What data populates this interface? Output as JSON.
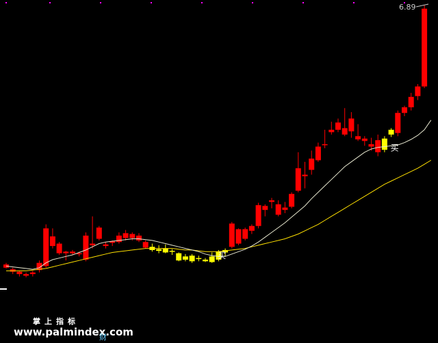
{
  "chart_data": {
    "type": "candlestick",
    "ylim": [
      3.3,
      6.93
    ],
    "price_label": "6.89",
    "signal_label": "买",
    "signals": [
      {
        "index": 32,
        "price": 3.82
      },
      {
        "index": 58,
        "price": 5.16
      }
    ],
    "candles": [
      {
        "o": 3.7,
        "h": 3.72,
        "l": 3.65,
        "c": 3.66,
        "color": "red"
      },
      {
        "o": 3.64,
        "h": 3.66,
        "l": 3.58,
        "c": 3.61,
        "color": "red"
      },
      {
        "o": 3.61,
        "h": 3.62,
        "l": 3.55,
        "c": 3.58,
        "color": "red"
      },
      {
        "o": 3.58,
        "h": 3.6,
        "l": 3.54,
        "c": 3.56,
        "color": "red"
      },
      {
        "o": 3.58,
        "h": 3.62,
        "l": 3.55,
        "c": 3.6,
        "color": "red"
      },
      {
        "o": 3.63,
        "h": 3.75,
        "l": 3.6,
        "c": 3.72,
        "color": "red"
      },
      {
        "o": 3.68,
        "h": 4.2,
        "l": 3.66,
        "c": 4.15,
        "color": "red"
      },
      {
        "o": 4.05,
        "h": 4.15,
        "l": 3.9,
        "c": 3.93,
        "color": "red"
      },
      {
        "o": 3.96,
        "h": 3.98,
        "l": 3.82,
        "c": 3.84,
        "color": "red"
      },
      {
        "o": 3.84,
        "h": 3.87,
        "l": 3.75,
        "c": 3.86,
        "color": "red"
      },
      {
        "o": 3.86,
        "h": 3.88,
        "l": 3.82,
        "c": 3.84,
        "color": "red"
      },
      {
        "o": 3.83,
        "h": 3.86,
        "l": 3.8,
        "c": 3.84,
        "color": "red"
      },
      {
        "o": 3.76,
        "h": 4.1,
        "l": 3.74,
        "c": 4.06,
        "color": "red"
      },
      {
        "o": 3.94,
        "h": 4.3,
        "l": 3.9,
        "c": 3.96,
        "color": "red"
      },
      {
        "o": 4.02,
        "h": 4.18,
        "l": 4.0,
        "c": 4.16,
        "color": "red"
      },
      {
        "o": 3.95,
        "h": 3.98,
        "l": 3.9,
        "c": 3.93,
        "color": "red"
      },
      {
        "o": 3.97,
        "h": 4.0,
        "l": 3.93,
        "c": 3.99,
        "color": "red"
      },
      {
        "o": 3.98,
        "h": 4.1,
        "l": 3.96,
        "c": 4.06,
        "color": "red"
      },
      {
        "o": 4.03,
        "h": 4.13,
        "l": 4.0,
        "c": 4.09,
        "color": "red"
      },
      {
        "o": 4.03,
        "h": 4.1,
        "l": 4.0,
        "c": 4.08,
        "color": "red"
      },
      {
        "o": 4.06,
        "h": 4.09,
        "l": 3.98,
        "c": 4.0,
        "color": "red"
      },
      {
        "o": 3.98,
        "h": 4.0,
        "l": 3.9,
        "c": 3.91,
        "color": "red"
      },
      {
        "o": 3.92,
        "h": 3.96,
        "l": 3.86,
        "c": 3.88,
        "color": "yellow"
      },
      {
        "o": 3.89,
        "h": 3.94,
        "l": 3.84,
        "c": 3.87,
        "color": "yellow"
      },
      {
        "o": 3.9,
        "h": 3.95,
        "l": 3.84,
        "c": 3.85,
        "color": "yellow"
      },
      {
        "o": 3.87,
        "h": 3.89,
        "l": 3.82,
        "c": 3.86,
        "color": "yellow"
      },
      {
        "o": 3.84,
        "h": 3.85,
        "l": 3.74,
        "c": 3.75,
        "color": "yellow"
      },
      {
        "o": 3.8,
        "h": 3.83,
        "l": 3.74,
        "c": 3.76,
        "color": "yellow"
      },
      {
        "o": 3.81,
        "h": 3.83,
        "l": 3.72,
        "c": 3.74,
        "color": "yellow"
      },
      {
        "o": 3.78,
        "h": 3.81,
        "l": 3.74,
        "c": 3.77,
        "color": "yellow"
      },
      {
        "o": 3.76,
        "h": 3.78,
        "l": 3.73,
        "c": 3.74,
        "color": "yellow"
      },
      {
        "o": 3.8,
        "h": 3.85,
        "l": 3.72,
        "c": 3.73,
        "color": "yellow"
      },
      {
        "o": 3.76,
        "h": 3.88,
        "l": 3.74,
        "c": 3.86,
        "color": "yellow"
      },
      {
        "o": 3.85,
        "h": 3.9,
        "l": 3.8,
        "c": 3.88,
        "color": "yellow"
      },
      {
        "o": 3.92,
        "h": 4.23,
        "l": 3.9,
        "c": 4.21,
        "color": "red"
      },
      {
        "o": 3.96,
        "h": 4.15,
        "l": 3.94,
        "c": 4.14,
        "color": "red"
      },
      {
        "o": 4.02,
        "h": 4.16,
        "l": 4.0,
        "c": 4.14,
        "color": "red"
      },
      {
        "o": 4.12,
        "h": 4.2,
        "l": 4.08,
        "c": 4.18,
        "color": "red"
      },
      {
        "o": 4.18,
        "h": 4.47,
        "l": 4.15,
        "c": 4.44,
        "color": "red"
      },
      {
        "o": 4.38,
        "h": 4.45,
        "l": 4.3,
        "c": 4.43,
        "color": "red"
      },
      {
        "o": 4.48,
        "h": 4.53,
        "l": 4.4,
        "c": 4.5,
        "color": "red"
      },
      {
        "o": 4.32,
        "h": 4.5,
        "l": 4.3,
        "c": 4.45,
        "color": "red"
      },
      {
        "o": 4.38,
        "h": 4.48,
        "l": 4.34,
        "c": 4.41,
        "color": "red"
      },
      {
        "o": 4.42,
        "h": 4.6,
        "l": 4.4,
        "c": 4.58,
        "color": "red"
      },
      {
        "o": 4.62,
        "h": 5.1,
        "l": 4.6,
        "c": 4.9,
        "color": "red"
      },
      {
        "o": 4.82,
        "h": 4.98,
        "l": 4.65,
        "c": 4.8,
        "color": "red"
      },
      {
        "o": 4.88,
        "h": 5.12,
        "l": 4.82,
        "c": 5.02,
        "color": "red"
      },
      {
        "o": 5.0,
        "h": 5.22,
        "l": 4.98,
        "c": 5.17,
        "color": "red"
      },
      {
        "o": 5.2,
        "h": 5.38,
        "l": 5.15,
        "c": 5.2,
        "color": "red"
      },
      {
        "o": 5.35,
        "h": 5.48,
        "l": 5.32,
        "c": 5.38,
        "color": "red"
      },
      {
        "o": 5.38,
        "h": 5.52,
        "l": 5.35,
        "c": 5.47,
        "color": "red"
      },
      {
        "o": 5.32,
        "h": 5.65,
        "l": 5.3,
        "c": 5.4,
        "color": "red"
      },
      {
        "o": 5.52,
        "h": 5.6,
        "l": 5.28,
        "c": 5.36,
        "color": "red"
      },
      {
        "o": 5.26,
        "h": 5.45,
        "l": 5.24,
        "c": 5.3,
        "color": "red"
      },
      {
        "o": 5.24,
        "h": 5.3,
        "l": 5.18,
        "c": 5.27,
        "color": "red"
      },
      {
        "o": 5.2,
        "h": 5.28,
        "l": 5.12,
        "c": 5.17,
        "color": "red"
      },
      {
        "o": 5.25,
        "h": 5.32,
        "l": 5.05,
        "c": 5.1,
        "color": "red"
      },
      {
        "o": 5.27,
        "h": 5.3,
        "l": 5.1,
        "c": 5.13,
        "color": "yellow"
      },
      {
        "o": 5.32,
        "h": 5.4,
        "l": 5.29,
        "c": 5.38,
        "color": "yellow"
      },
      {
        "o": 5.34,
        "h": 5.62,
        "l": 5.3,
        "c": 5.59,
        "color": "red"
      },
      {
        "o": 5.59,
        "h": 5.68,
        "l": 5.55,
        "c": 5.66,
        "color": "red"
      },
      {
        "o": 5.66,
        "h": 5.84,
        "l": 5.62,
        "c": 5.79,
        "color": "red"
      },
      {
        "o": 5.8,
        "h": 5.95,
        "l": 5.75,
        "c": 5.92,
        "color": "red"
      },
      {
        "o": 5.92,
        "h": 6.93,
        "l": 5.9,
        "c": 6.89,
        "color": "red"
      }
    ],
    "ma_short": [
      3.68,
      3.67,
      3.66,
      3.65,
      3.64,
      3.66,
      3.72,
      3.76,
      3.78,
      3.8,
      3.82,
      3.85,
      3.88,
      3.92,
      3.96,
      3.98,
      3.99,
      4.0,
      4.01,
      4.02,
      4.02,
      4.01,
      4.0,
      3.98,
      3.96,
      3.94,
      3.92,
      3.9,
      3.88,
      3.86,
      3.83,
      3.81,
      3.8,
      3.8,
      3.83,
      3.86,
      3.89,
      3.93,
      3.98,
      4.04,
      4.1,
      4.16,
      4.22,
      4.29,
      4.36,
      4.43,
      4.52,
      4.6,
      4.68,
      4.76,
      4.84,
      4.92,
      4.98,
      5.04,
      5.1,
      5.14,
      5.16,
      5.17,
      5.18,
      5.19,
      5.22,
      5.26,
      5.31,
      5.38,
      5.5
    ],
    "ma_long": [
      3.62,
      3.62,
      3.62,
      3.62,
      3.63,
      3.64,
      3.65,
      3.67,
      3.69,
      3.71,
      3.73,
      3.75,
      3.77,
      3.79,
      3.81,
      3.83,
      3.85,
      3.86,
      3.87,
      3.88,
      3.89,
      3.9,
      3.9,
      3.9,
      3.9,
      3.9,
      3.89,
      3.88,
      3.88,
      3.87,
      3.86,
      3.86,
      3.86,
      3.87,
      3.88,
      3.89,
      3.9,
      3.92,
      3.94,
      3.96,
      3.98,
      4.0,
      4.02,
      4.05,
      4.08,
      4.12,
      4.16,
      4.2,
      4.25,
      4.3,
      4.35,
      4.4,
      4.45,
      4.5,
      4.55,
      4.6,
      4.65,
      4.7,
      4.74,
      4.78,
      4.82,
      4.86,
      4.9,
      4.95,
      5.0
    ]
  },
  "watermark": {
    "title": "掌上指标",
    "url": "www.palmindex.com",
    "sub": "财"
  },
  "colors": {
    "background": "#000000",
    "red_candle": "#ff0000",
    "yellow_candle": "#ffff00",
    "ma_short": "#e8e8d0",
    "ma_long": "#ffe000",
    "grid_dot": "#ff00ff"
  }
}
